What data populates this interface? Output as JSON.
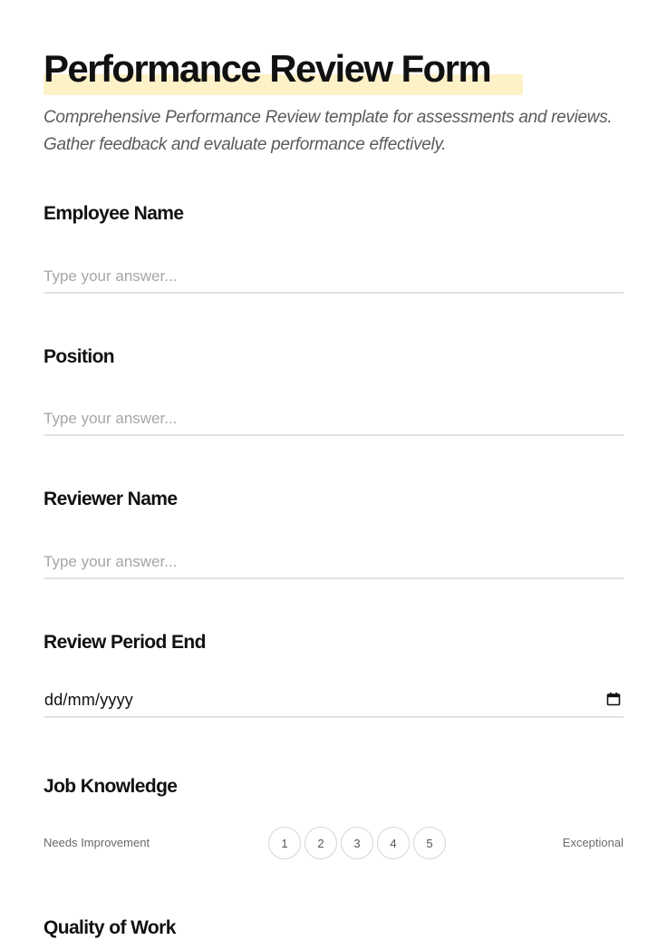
{
  "form": {
    "title": "Performance Review Form",
    "subtitle": "Comprehensive Performance Review template for assessments and reviews. Gather feedback and evaluate performance effectively.",
    "highlight_color": "#fdf1c8"
  },
  "questions": {
    "employee_name": {
      "label": "Employee Name",
      "placeholder": "Type your answer...",
      "value": ""
    },
    "position": {
      "label": "Position",
      "placeholder": "Type your answer...",
      "value": ""
    },
    "reviewer_name": {
      "label": "Reviewer Name",
      "placeholder": "Type your answer...",
      "value": ""
    },
    "review_period_end": {
      "label": "Review Period End",
      "value": "dd/mm/yyyy",
      "icon": "calendar-icon"
    },
    "job_knowledge": {
      "label": "Job Knowledge",
      "low_label": "Needs Improvement",
      "high_label": "Exceptional",
      "options": [
        "1",
        "2",
        "3",
        "4",
        "5"
      ]
    },
    "quality_of_work": {
      "label": "Quality of Work"
    }
  }
}
